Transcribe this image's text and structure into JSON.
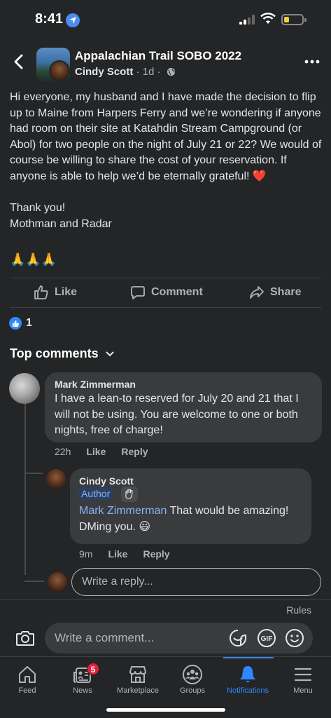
{
  "status": {
    "time": "8:41",
    "battery_level": 0.3
  },
  "header": {
    "group_title": "Appalachian Trail SOBO 2022",
    "author": "Cindy Scott",
    "time_ago": "· 1d ·"
  },
  "post": {
    "text": "Hi everyone, my husband and I have made the decision to flip up to Maine from Harpers Ferry and we’re wondering if anyone had room on their site at Katahdin Stream Campground (or Abol) for two people on the night of July 21 or 22? We would of course be willing to share the cost of your reservation.  If anyone is able to help we’d be eternally grateful!",
    "heart": "❤️",
    "closing": "Thank you!\nMothman and Radar",
    "emoji": "🙏🙏🙏"
  },
  "actions": {
    "like": "Like",
    "comment": "Comment",
    "share": "Share"
  },
  "reactions": {
    "count": "1"
  },
  "comments_header": "Top comments",
  "comments": [
    {
      "name": "Mark Zimmerman",
      "text": "I have a lean-to reserved for July 20 and 21 that I will not be using.  You are welcome to one or both nights, free of charge!",
      "time": "22h",
      "like": "Like",
      "reply": "Reply"
    },
    {
      "name": "Cindy Scott",
      "badge": "Author",
      "mention": "Mark Zimmerman",
      "text": " That would be amazing! DMing you. 😃",
      "time": "9m",
      "like": "Like",
      "reply": "Reply"
    }
  ],
  "reply_placeholder": "Write a reply...",
  "rules": "Rules",
  "comment_placeholder": "Write a comment...",
  "tabs": [
    {
      "label": "Feed",
      "icon": "home-icon"
    },
    {
      "label": "News",
      "icon": "news-icon",
      "badge": "5"
    },
    {
      "label": "Marketplace",
      "icon": "marketplace-icon"
    },
    {
      "label": "Groups",
      "icon": "groups-icon"
    },
    {
      "label": "Notifications",
      "icon": "bell-icon",
      "active": true
    },
    {
      "label": "Menu",
      "icon": "menu-icon"
    }
  ],
  "colors": {
    "accent": "#2d88ff",
    "background": "#242526",
    "bubble": "#3a3b3c",
    "badge": "#e41e3f"
  }
}
